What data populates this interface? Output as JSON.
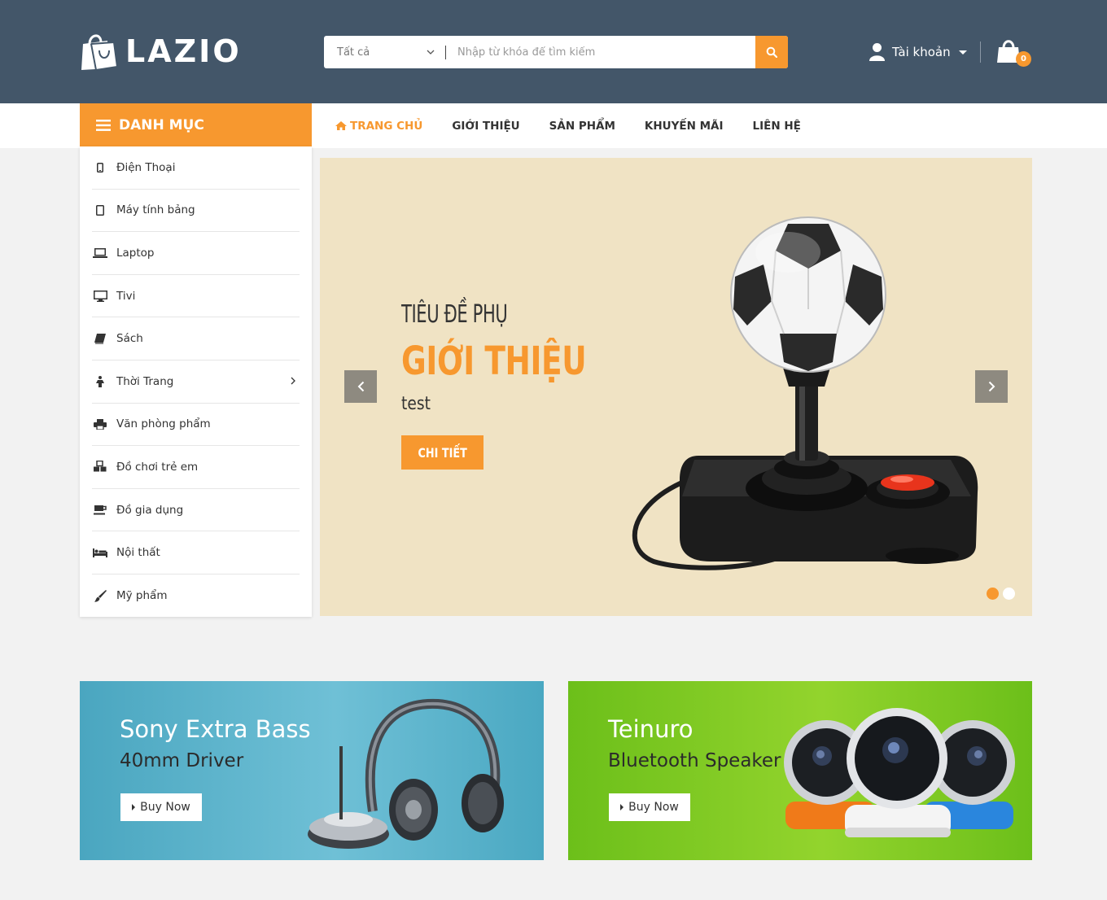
{
  "header": {
    "logo_text": "LAZIO",
    "search": {
      "category_value": "Tất cả",
      "placeholder": "Nhập từ khóa để tìm kiếm"
    },
    "account_label": "Tài khoản",
    "cart_count": "0"
  },
  "nav": {
    "category_title": "DANH MỤC",
    "menu": [
      {
        "label": "TRANG CHỦ",
        "active": true
      },
      {
        "label": "GIỚI THIỆU"
      },
      {
        "label": "SẢN PHẨM"
      },
      {
        "label": "KHUYẾN MÃI"
      },
      {
        "label": "LIÊN HỆ"
      }
    ]
  },
  "categories": [
    {
      "label": "Điện Thoại",
      "icon": "mobile-icon"
    },
    {
      "label": "Máy tính bảng",
      "icon": "tablet-icon"
    },
    {
      "label": "Laptop",
      "icon": "laptop-icon"
    },
    {
      "label": "Tivi",
      "icon": "desktop-icon"
    },
    {
      "label": "Sách",
      "icon": "book-icon"
    },
    {
      "label": "Thời Trang",
      "icon": "female-icon",
      "has_submenu": true
    },
    {
      "label": "Văn phòng phẩm",
      "icon": "printer-icon"
    },
    {
      "label": "Đồ chơi trẻ em",
      "icon": "cubes-icon"
    },
    {
      "label": "Đồ gia dụng",
      "icon": "coffee-icon"
    },
    {
      "label": "Nội thất",
      "icon": "bed-icon"
    },
    {
      "label": "Mỹ phẩm",
      "icon": "paint-brush-icon"
    }
  ],
  "slider": {
    "subtitle": "TIÊU ĐỀ PHỤ",
    "title": "GIỚI THIỆU",
    "description": "test",
    "button_label": "CHI TIẾT",
    "active_slide": 1,
    "slide_count": 2
  },
  "banners": [
    {
      "title": "Sony Extra Bass",
      "subtitle": "40mm Driver",
      "button_label": "Buy Now"
    },
    {
      "title": "Teinuro",
      "subtitle": "Bluetooth Speaker",
      "button_label": "Buy Now"
    }
  ],
  "colors": {
    "header_bg": "#435669",
    "accent": "#f7982f",
    "slide_bg": "#f0e3c4",
    "banner_blue": "#4aa6c0",
    "banner_green": "#7cc621"
  }
}
